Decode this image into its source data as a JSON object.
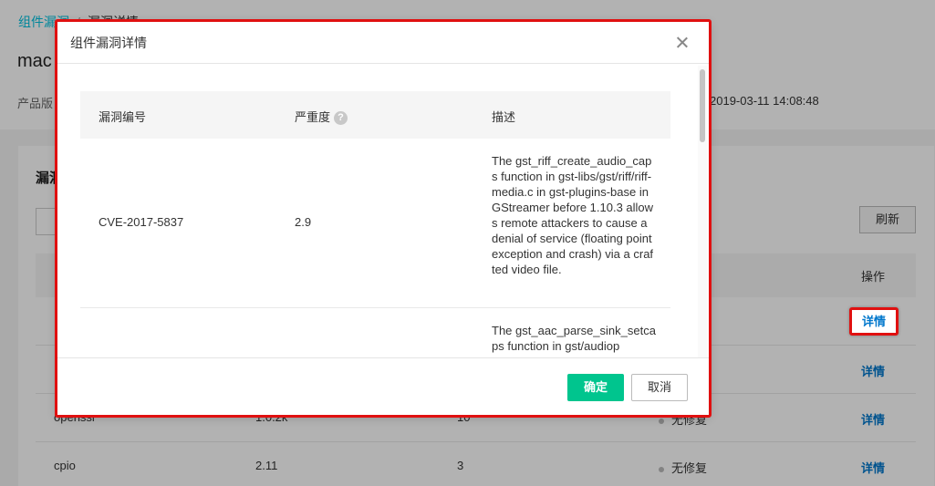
{
  "breadcrumb": {
    "parent": "组件漏洞",
    "current": "漏洞详情"
  },
  "page": {
    "title": "mac",
    "meta_label": "产品版",
    "meta_time": "2019-03-11 14:08:48",
    "card_title": "漏洞",
    "search_placeholder": "请",
    "refresh_label": "刷新",
    "op_header": "操作",
    "rows": [
      {
        "name": "",
        "version": "",
        "count": "",
        "status": "",
        "action": "详情"
      },
      {
        "name": "",
        "version": "",
        "count": "",
        "status": "",
        "action": "详情"
      },
      {
        "name": "openssl",
        "version": "1.0.2k",
        "count": "10",
        "status": "无修复",
        "action": "详情"
      },
      {
        "name": "cpio",
        "version": "2.11",
        "count": "3",
        "status": "无修复",
        "action": "详情"
      }
    ]
  },
  "modal": {
    "title": "组件漏洞详情",
    "columns": {
      "id": "漏洞编号",
      "severity": "严重度",
      "desc": "描述"
    },
    "help_glyph": "?",
    "rows": [
      {
        "id": "CVE-2017-5837",
        "severity": "2.9",
        "desc": "The gst_riff_create_audio_caps function in gst-libs/gst/riff/riff-media.c in gst-plugins-base in GStreamer before 1.10.3 allows remote attackers to cause a denial of service (floating point exception and crash) via a crafted video file."
      },
      {
        "id": "",
        "severity": "",
        "desc": "The gst_aac_parse_sink_setcaps function in gst/audiop"
      }
    ],
    "ok_label": "确定",
    "cancel_label": "取消"
  },
  "colors": {
    "accent_green": "#00c58e",
    "link_blue": "#0077cc",
    "highlight_red": "#e01010"
  }
}
